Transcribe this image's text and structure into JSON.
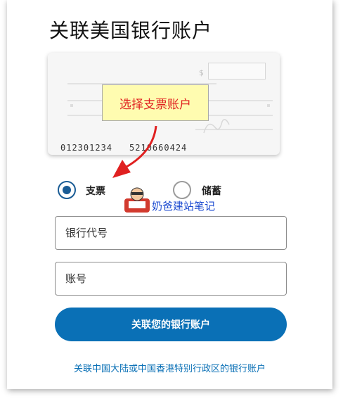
{
  "page": {
    "title": "关联美国银行账户"
  },
  "check_image": {
    "dollar_sign": "$",
    "routing_number": "012301234",
    "account_number": "5210660424"
  },
  "callout": {
    "text": "选择支票账户"
  },
  "account_type": {
    "options": [
      {
        "label": "支票",
        "selected": true
      },
      {
        "label": "储蓄",
        "selected": false
      }
    ]
  },
  "watermark": {
    "text": "奶爸建站笔记"
  },
  "form": {
    "routing_placeholder": "银行代号",
    "account_placeholder": "账号",
    "submit_label": "关联您的银行账户"
  },
  "footer": {
    "link_text": "关联中国大陆或中国香港特别行政区的银行账户"
  },
  "colors": {
    "primary": "#0a70b6",
    "radio_selected": "#1a5c95",
    "callout_bg": "#fffcb0",
    "callout_text": "#e02020",
    "arrow": "#e02020",
    "watermark": "#1b4ad0"
  }
}
